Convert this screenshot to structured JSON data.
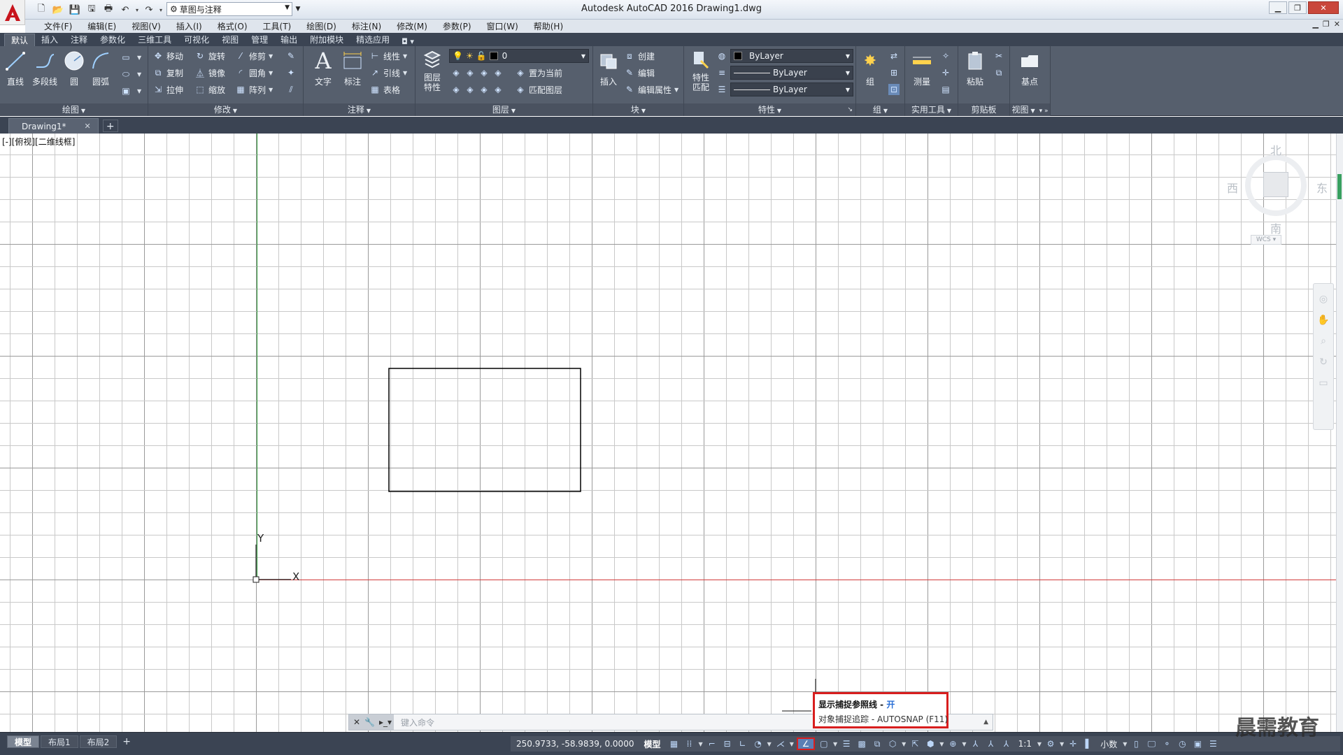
{
  "app": {
    "title": "Autodesk AutoCAD 2016    Drawing1.dwg",
    "workspace": "草图与注释"
  },
  "menu": [
    "文件(F)",
    "编辑(E)",
    "视图(V)",
    "插入(I)",
    "格式(O)",
    "工具(T)",
    "绘图(D)",
    "标注(N)",
    "修改(M)",
    "参数(P)",
    "窗口(W)",
    "帮助(H)"
  ],
  "ribbon_tabs": [
    "默认",
    "插入",
    "注释",
    "参数化",
    "三维工具",
    "可视化",
    "视图",
    "管理",
    "输出",
    "附加模块",
    "精选应用"
  ],
  "ribbon": {
    "draw": {
      "title": "绘图",
      "line": "直线",
      "polyline": "多段线",
      "circle": "圆",
      "arc": "圆弧"
    },
    "modify": {
      "title": "修改",
      "move": "移动",
      "rotate": "旋转",
      "trim": "修剪",
      "copy": "复制",
      "mirror": "镜像",
      "fillet": "圆角",
      "stretch": "拉伸",
      "scale": "缩放",
      "array": "阵列"
    },
    "annotation": {
      "title": "注释",
      "text": "文字",
      "dimension": "标注",
      "linear": "线性",
      "leader": "引线",
      "table": "表格"
    },
    "layers": {
      "title": "图层",
      "properties": "图层\n特性",
      "layer_value": "0",
      "set_current": "置为当前",
      "match_layer": "匹配图层"
    },
    "block": {
      "title": "块",
      "insert": "插入",
      "create": "创建",
      "edit": "编辑",
      "edit_attributes": "编辑属性"
    },
    "properties": {
      "title": "特性",
      "match": "特性\n匹配",
      "color": "ByLayer",
      "linetype": "ByLayer",
      "lineweight": "ByLayer"
    },
    "groups": {
      "title": "组",
      "group": "组"
    },
    "utilities": {
      "title": "实用工具",
      "measure": "测量"
    },
    "clipboard": {
      "title": "剪贴板",
      "paste": "粘贴"
    },
    "view": {
      "title": "视图",
      "base": "基点"
    }
  },
  "file_tabs": [
    {
      "label": "Drawing1*"
    }
  ],
  "canvas": {
    "view_label": "[-][俯视][二维线框]",
    "viewcube": {
      "north": "北",
      "south": "南",
      "east": "东",
      "west": "西",
      "wcs": "WCS"
    },
    "ucs_x": "X",
    "ucs_y": "Y"
  },
  "command_line": {
    "placeholder": "键入命令"
  },
  "tooltip": {
    "title": "显示捕捉参照线 - ",
    "state": "开",
    "detail": "对象捕捉追踪 - AUTOSNAP (F11)"
  },
  "status": {
    "layout_tabs": [
      "模型",
      "布局1",
      "布局2"
    ],
    "coordinates": "250.9733, -58.9839, 0.0000",
    "model": "模型",
    "scale": "1:1",
    "units": "小数"
  },
  "watermark": "晨需教育",
  "colors": {
    "ribbon_bg": "#565f6d",
    "tab_bg": "#3b4453",
    "highlight": "#d81e1e",
    "x_axis": "#d23a3a",
    "y_axis": "#2f9a3a"
  }
}
